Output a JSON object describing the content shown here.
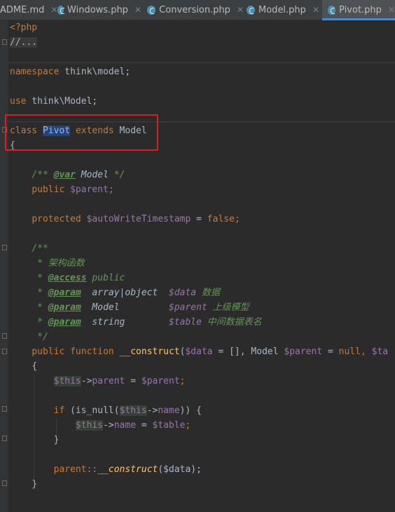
{
  "tabs": [
    {
      "label": "ADME.md",
      "active": false
    },
    {
      "label": "Windows.php",
      "active": false
    },
    {
      "label": "Conversion.php",
      "active": false
    },
    {
      "label": "Model.php",
      "active": false
    },
    {
      "label": "Pivot.php",
      "active": true
    }
  ],
  "code": {
    "php_open": "<?php",
    "folded_comment": "//...",
    "namespace_kw": "namespace",
    "namespace_name": " think\\model;",
    "use_kw": "use",
    "use_name": " think\\Model;",
    "class_kw": "class",
    "class_name": "Pivot",
    "extends_kw": "extends",
    "parent_class": " Model",
    "brace_open": "{",
    "doc_var_open": "/** ",
    "doc_var_tag": "@var",
    "doc_var_type": " Model",
    "doc_var_close": " */",
    "public_kw": "public",
    "parent_prop": "$parent",
    "semicolon": ";",
    "protected_kw": "protected",
    "auto_prop": "$autoWriteTimestamp",
    "assign": " = ",
    "false_kw": "false",
    "doc_open": "/**",
    "doc_desc": " * 架构函数",
    "star": " * ",
    "access_tag": "@access",
    "access_val": " public",
    "param_tag": "@param",
    "p1_type": "  array|object  ",
    "p1_name": "$data",
    "p1_desc": " 数据",
    "p2_type": "  Model         ",
    "p2_name": "$parent",
    "p2_desc": " 上级模型",
    "p3_type": "  string        ",
    "p3_name": "$table",
    "p3_desc": " 中间数据表名",
    "doc_close": " */",
    "function_kw": "function",
    "ctor_name": "__construct",
    "sig_open": "(",
    "sig_data": "$data",
    "sig_mid1": " = [], Model ",
    "sig_parent": "$parent",
    "sig_mid2": " = ",
    "null_kw": "null",
    "sig_comma": ", ",
    "sig_tail": "$ta",
    "this_kw": "$this",
    "arrow": "->",
    "parent_word": "parent",
    "parent_value": "$parent",
    "if_kw": "if",
    "is_null_call": " (is_null(",
    "name_word": "name",
    "if_close": ")) {",
    "table_var": "$table",
    "close_brace": "}",
    "parent_call": "parent::",
    "call_args": "($data);"
  }
}
